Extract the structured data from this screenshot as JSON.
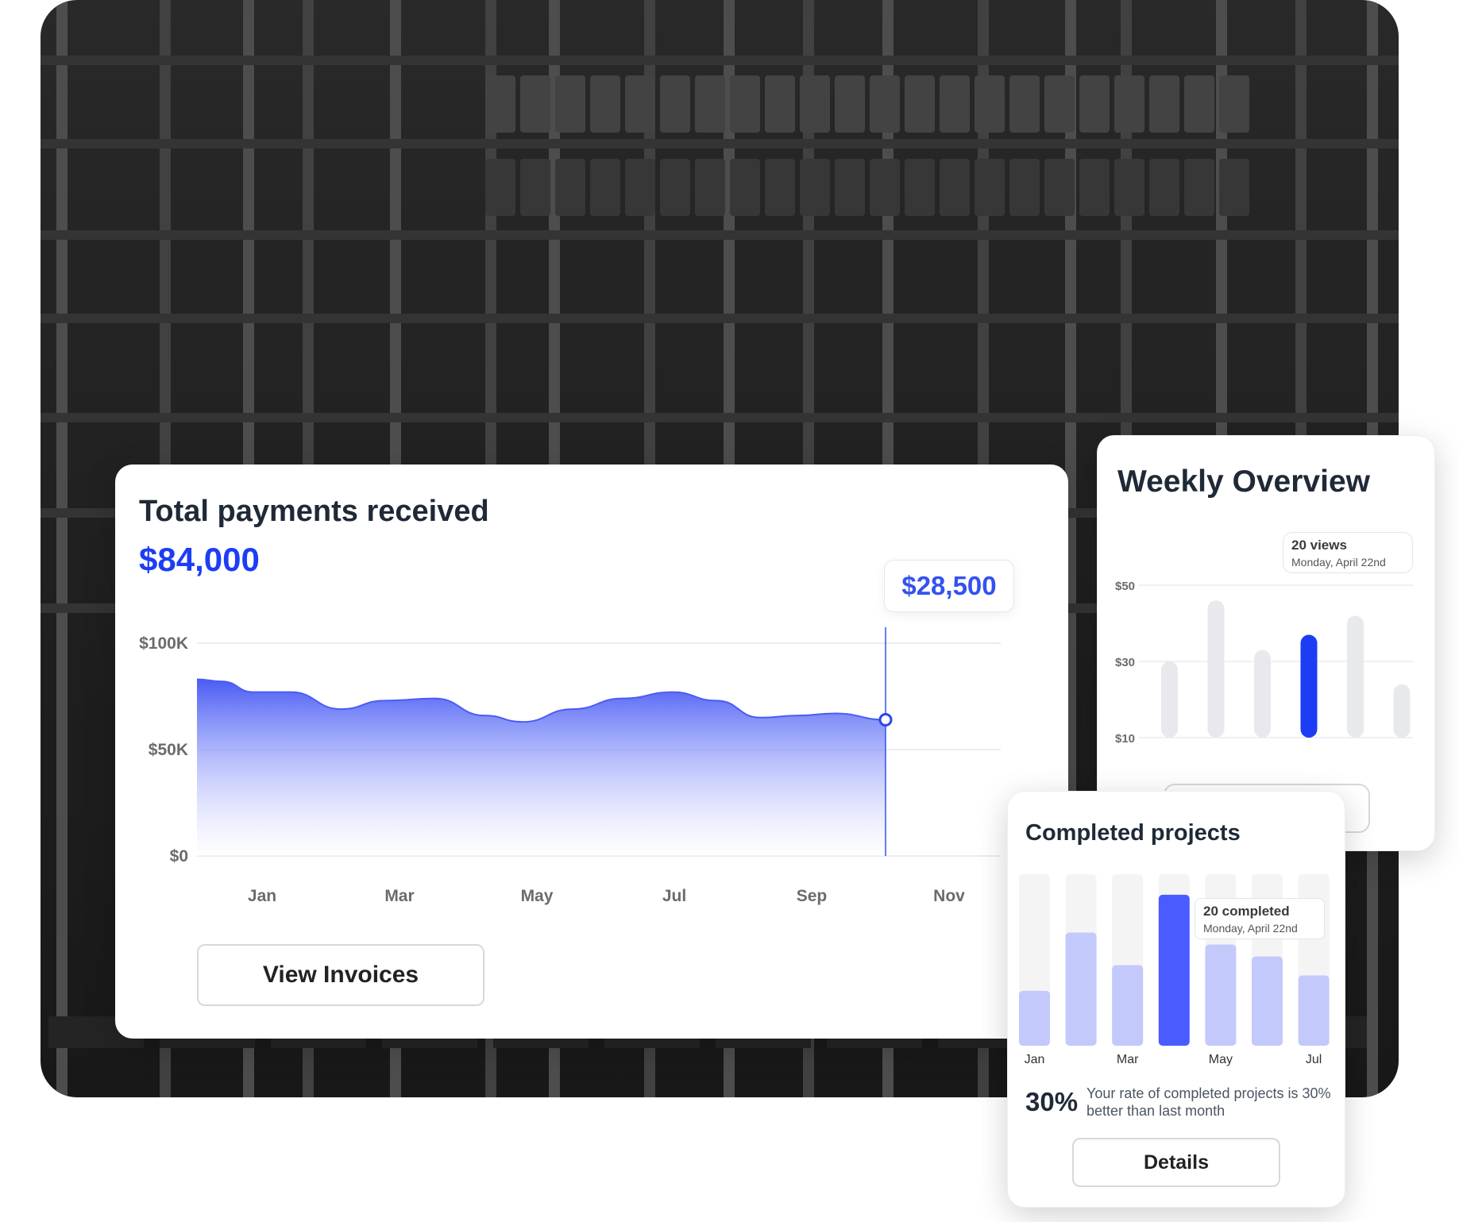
{
  "payments": {
    "title": "Total payments received",
    "total": "$84,000",
    "tooltip_value": "$28,500",
    "button_label": "View Invoices",
    "accent_color": "#1d3df5",
    "chart_data": {
      "type": "area",
      "y_ticks": [
        "$100K",
        "$50K",
        "$0"
      ],
      "x_ticks": [
        "Jan",
        "Mar",
        "May",
        "Jul",
        "Sep",
        "Nov"
      ],
      "ylim": [
        0,
        100000
      ],
      "xlim": [
        0,
        11
      ],
      "x": [
        0,
        0.4,
        0.9,
        1.5,
        2.3,
        3,
        3.8,
        4.6,
        5.2,
        6,
        6.8,
        7.6,
        8.3,
        9,
        9.6,
        10.2,
        11
      ],
      "values": [
        83000,
        82000,
        77000,
        77000,
        69000,
        73000,
        74000,
        66000,
        63000,
        69000,
        74000,
        77000,
        73000,
        65000,
        66000,
        67000,
        64000
      ],
      "highlight_index": 16
    }
  },
  "weekly": {
    "title": "Weekly Overview",
    "tooltip_main": "20 views",
    "tooltip_sub": "Monday, April 22nd",
    "chart_data": {
      "type": "bar",
      "y_ticks": [
        "$50",
        "$30",
        "$10"
      ],
      "ylim": [
        10,
        50
      ],
      "values": [
        30,
        46,
        33,
        37,
        42,
        24
      ],
      "highlight_index": 3,
      "highlight_color": "#1d3df5",
      "bar_color": "#e7e9ed"
    }
  },
  "projects": {
    "title": "Completed projects",
    "tooltip_main": "20 completed",
    "tooltip_sub": "Monday, April 22nd",
    "rate_value": "30%",
    "rate_text": "Your rate of completed projects is 30% better than last month",
    "button_label": "Details",
    "chart_data": {
      "type": "bar",
      "x_ticks": [
        "Jan",
        "",
        "Mar",
        "",
        "May",
        "",
        "Jul"
      ],
      "ylim": [
        0,
        1
      ],
      "values": [
        0.32,
        0.66,
        0.47,
        0.88,
        0.59,
        0.52,
        0.41
      ],
      "highlight_index": 3,
      "highlight_color": "#4a5cff",
      "bar_color": "#c3c9fb",
      "track_color": "#f4f4f5"
    }
  }
}
